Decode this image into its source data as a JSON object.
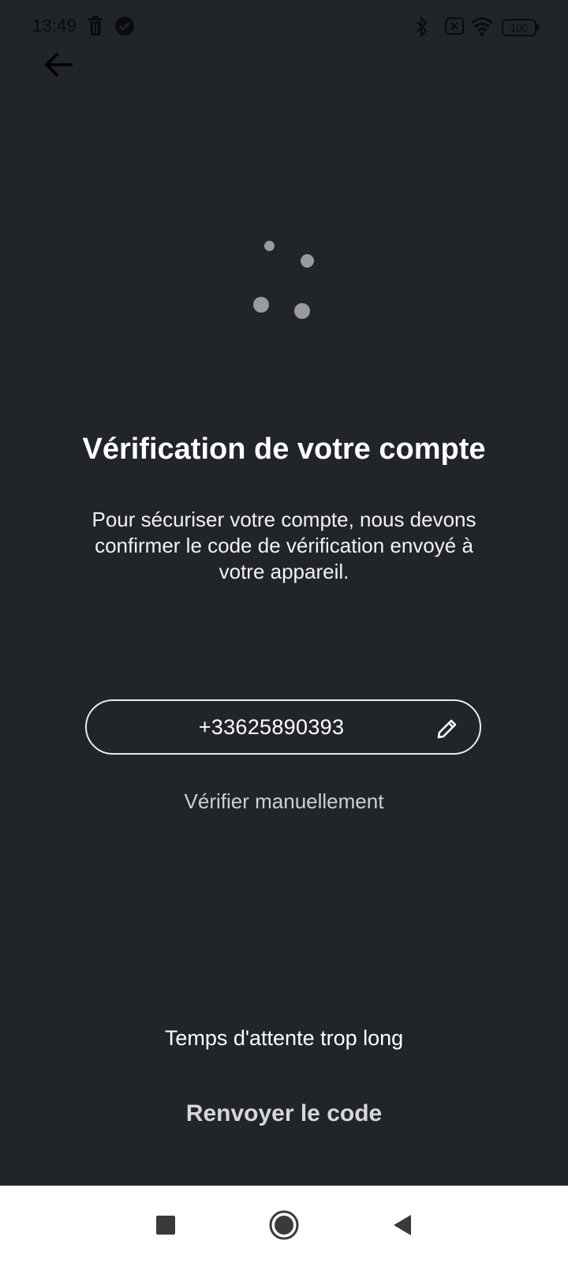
{
  "status_bar": {
    "time": "13:49",
    "battery": "100",
    "icons": [
      "delete-icon",
      "check-circle-icon",
      "bluetooth-icon",
      "no-sim-icon",
      "wifi-icon",
      "battery-icon"
    ]
  },
  "header": {
    "back_icon": "arrow-left-icon"
  },
  "main": {
    "title": "Vérification de votre compte",
    "description": "Pour sécuriser votre compte, nous devons confirmer le code de vérification envoyé à votre appareil.",
    "phone_number": "+33625890393",
    "edit_icon": "pencil-icon",
    "verify_manually": "Vérifier manuellement"
  },
  "footer": {
    "wait_text": "Temps d'attente trop long",
    "resend_label": "Renvoyer le code"
  },
  "nav_bar": {
    "buttons": [
      "recents-square-icon",
      "home-circle-icon",
      "back-triangle-icon"
    ]
  },
  "colors": {
    "background": "#212429",
    "text_primary": "#ffffff",
    "text_secondary": "#cfd0d2",
    "spinner_dot": "#9a9b9d",
    "nav_bar": "#ffffff"
  }
}
